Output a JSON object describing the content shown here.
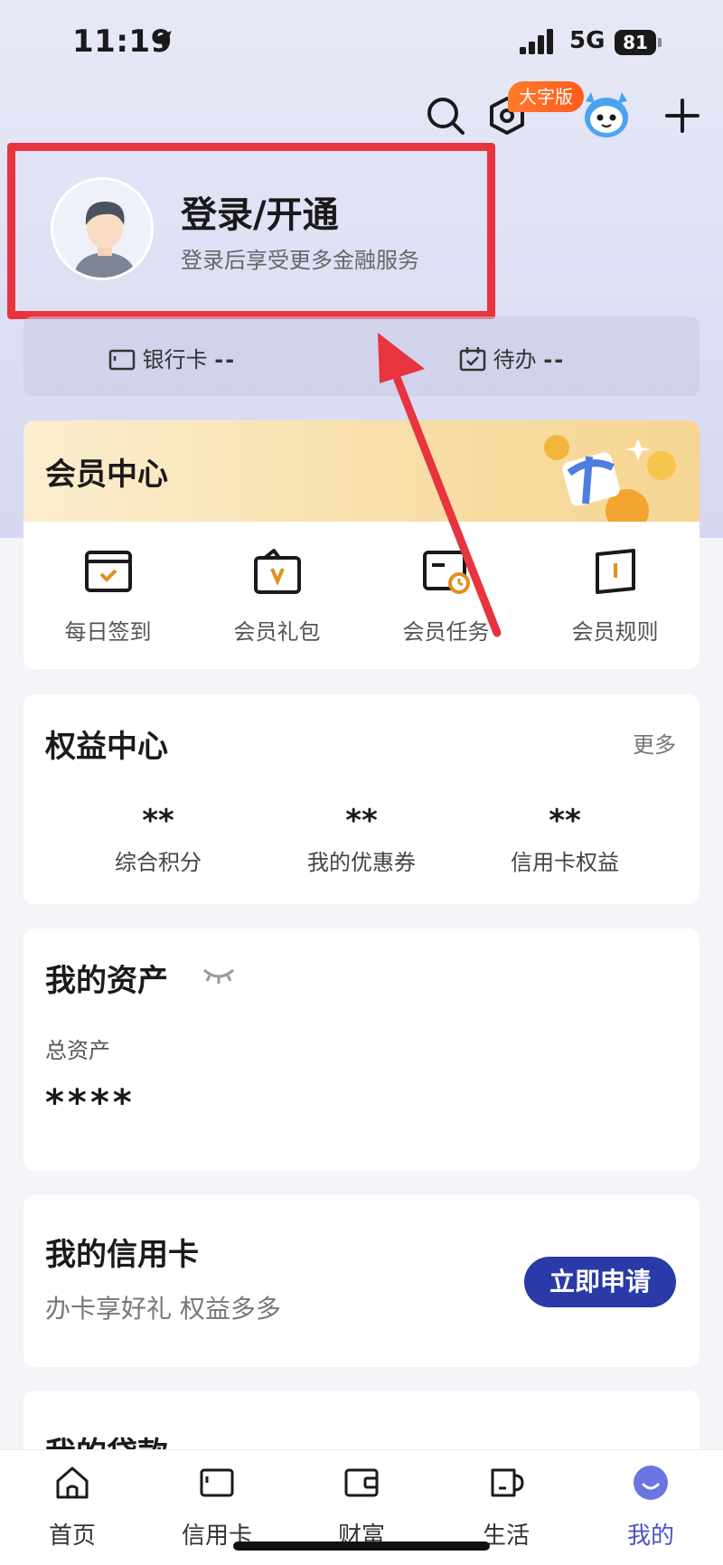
{
  "status": {
    "time": "11:19",
    "network": "5G",
    "battery": "81"
  },
  "header": {
    "bigfont_badge": "大字版"
  },
  "login": {
    "title": "登录/开通",
    "subtitle": "登录后享受更多金融服务"
  },
  "quick": {
    "bank_card_label": "银行卡",
    "bank_card_value": "--",
    "todo_label": "待办",
    "todo_value": "--"
  },
  "member": {
    "title": "会员中心",
    "items": [
      {
        "label": "每日签到",
        "icon": "checkin-icon"
      },
      {
        "label": "会员礼包",
        "icon": "gift-pack-icon"
      },
      {
        "label": "会员任务",
        "icon": "task-icon"
      },
      {
        "label": "会员规则",
        "icon": "rules-icon"
      }
    ]
  },
  "benefits": {
    "title": "权益中心",
    "more": "更多",
    "stats": [
      {
        "value": "**",
        "label": "综合积分"
      },
      {
        "value": "**",
        "label": "我的优惠券"
      },
      {
        "value": "**",
        "label": "信用卡权益"
      }
    ]
  },
  "assets": {
    "title": "我的资产",
    "total_label": "总资产",
    "total_value": "****"
  },
  "credit": {
    "title": "我的信用卡",
    "subtitle": "办卡享好礼 权益多多",
    "apply": "立即申请"
  },
  "loan": {
    "title": "我的贷款"
  },
  "tabs": [
    {
      "label": "首页",
      "icon": "home-icon"
    },
    {
      "label": "信用卡",
      "icon": "credit-card-icon"
    },
    {
      "label": "财富",
      "icon": "wallet-icon"
    },
    {
      "label": "生活",
      "icon": "cup-icon"
    },
    {
      "label": "我的",
      "icon": "profile-icon",
      "active": true
    }
  ],
  "colors": {
    "accent": "#2a3aa8",
    "annotation": "#e8343f",
    "badge": "#ff6a22"
  }
}
